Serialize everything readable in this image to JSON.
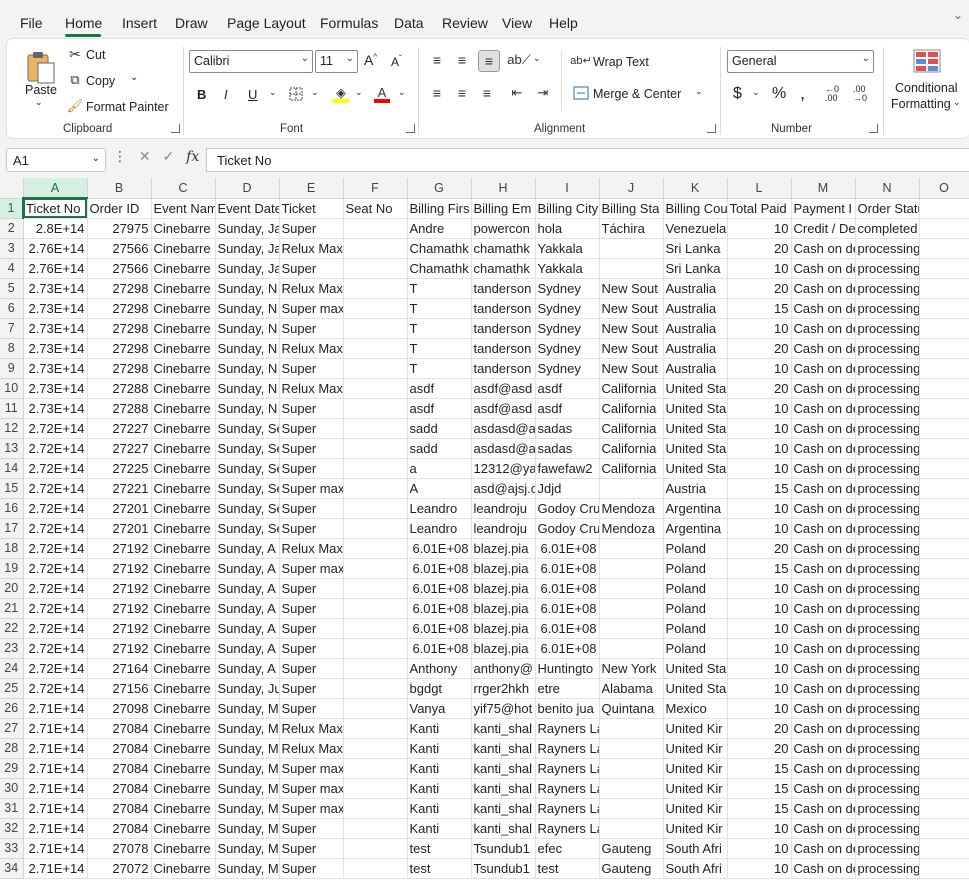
{
  "menu": {
    "tabs": [
      "File",
      "Home",
      "Insert",
      "Draw",
      "Page Layout",
      "Formulas",
      "Data",
      "Review",
      "View",
      "Help"
    ],
    "active": "Home"
  },
  "ribbon": {
    "clipboard": {
      "paste": "Paste",
      "cut": "Cut",
      "copy": "Copy",
      "format_painter": "Format Painter",
      "label": "Clipboard"
    },
    "font": {
      "name": "Calibri",
      "size": "11",
      "bold": "B",
      "italic": "I",
      "underline": "U",
      "label": "Font",
      "fill_color": "#ffff00",
      "font_color": "#ff0000"
    },
    "alignment": {
      "wrap_text": "Wrap Text",
      "merge_center": "Merge & Center",
      "label": "Alignment"
    },
    "number": {
      "format": "General",
      "label": "Number"
    },
    "styles": {
      "conditional_formatting_1": "Conditional",
      "conditional_formatting_2": "Formatting"
    }
  },
  "formula_bar": {
    "name_box": "A1",
    "formula": "Ticket No"
  },
  "sheet": {
    "columns": [
      "A",
      "B",
      "C",
      "D",
      "E",
      "F",
      "G",
      "H",
      "I",
      "J",
      "K",
      "L",
      "M",
      "N",
      "O"
    ],
    "rows": [
      [
        "Ticket No",
        "Order ID",
        "Event Nam",
        "Event Date",
        "Ticket",
        "Seat No",
        "Billing Firs",
        "Billing Em",
        "Billing City",
        "Billing Sta",
        "Billing Cou",
        "Total Paid",
        "Payment I",
        "Order Status",
        ""
      ],
      [
        "2.8E+14",
        "27975",
        "Cinebarre",
        "Sunday, Ja",
        "Super",
        "",
        "Andre",
        "powercon",
        "hola",
        "Táchira",
        "Venezuela",
        "10",
        "Credit / De",
        "completed",
        ""
      ],
      [
        "2.76E+14",
        "27566",
        "Cinebarre",
        "Sunday, Ja",
        "Relux Max",
        "",
        "Chamathk",
        "chamathk",
        "Yakkala",
        "",
        "Sri Lanka",
        "20",
        "Cash on de",
        "processing",
        ""
      ],
      [
        "2.76E+14",
        "27566",
        "Cinebarre",
        "Sunday, Ja",
        "Super",
        "",
        "Chamathk",
        "chamathk",
        "Yakkala",
        "",
        "Sri Lanka",
        "10",
        "Cash on de",
        "processing",
        ""
      ],
      [
        "2.73E+14",
        "27298",
        "Cinebarre",
        "Sunday, N",
        "Relux Max",
        "",
        "T",
        "tanderson",
        "Sydney",
        "New Sout",
        "Australia",
        "20",
        "Cash on de",
        "processing",
        ""
      ],
      [
        "2.73E+14",
        "27298",
        "Cinebarre",
        "Sunday, N",
        "Super max",
        "",
        "T",
        "tanderson",
        "Sydney",
        "New Sout",
        "Australia",
        "15",
        "Cash on de",
        "processing",
        ""
      ],
      [
        "2.73E+14",
        "27298",
        "Cinebarre",
        "Sunday, N",
        "Super",
        "",
        "T",
        "tanderson",
        "Sydney",
        "New Sout",
        "Australia",
        "10",
        "Cash on de",
        "processing",
        ""
      ],
      [
        "2.73E+14",
        "27298",
        "Cinebarre",
        "Sunday, N",
        "Relux Max",
        "",
        "T",
        "tanderson",
        "Sydney",
        "New Sout",
        "Australia",
        "20",
        "Cash on de",
        "processing",
        ""
      ],
      [
        "2.73E+14",
        "27298",
        "Cinebarre",
        "Sunday, N",
        "Super",
        "",
        "T",
        "tanderson",
        "Sydney",
        "New Sout",
        "Australia",
        "10",
        "Cash on de",
        "processing",
        ""
      ],
      [
        "2.73E+14",
        "27288",
        "Cinebarre",
        "Sunday, N",
        "Relux Max",
        "",
        "asdf",
        "asdf@asd",
        "asdf",
        "California",
        "United Sta",
        "20",
        "Cash on de",
        "processing",
        ""
      ],
      [
        "2.73E+14",
        "27288",
        "Cinebarre",
        "Sunday, N",
        "Super",
        "",
        "asdf",
        "asdf@asd",
        "asdf",
        "California",
        "United Sta",
        "10",
        "Cash on de",
        "processing",
        ""
      ],
      [
        "2.72E+14",
        "27227",
        "Cinebarre",
        "Sunday, Se",
        "Super",
        "",
        "sadd",
        "asdasd@a",
        "sadas",
        "California",
        "United Sta",
        "10",
        "Cash on de",
        "processing",
        ""
      ],
      [
        "2.72E+14",
        "27227",
        "Cinebarre",
        "Sunday, Se",
        "Super",
        "",
        "sadd",
        "asdasd@a",
        "sadas",
        "California",
        "United Sta",
        "10",
        "Cash on de",
        "processing",
        ""
      ],
      [
        "2.72E+14",
        "27225",
        "Cinebarre",
        "Sunday, Se",
        "Super",
        "",
        "a",
        "12312@ya",
        "fawefaw2",
        "California",
        "United Sta",
        "10",
        "Cash on de",
        "processing",
        ""
      ],
      [
        "2.72E+14",
        "27221",
        "Cinebarre",
        "Sunday, Se",
        "Super max",
        "",
        "A",
        "asd@ajsj.c",
        "Jdjd",
        "",
        "Austria",
        "15",
        "Cash on de",
        "processing",
        ""
      ],
      [
        "2.72E+14",
        "27201",
        "Cinebarre",
        "Sunday, Se",
        "Super",
        "",
        "Leandro",
        "leandroju",
        "Godoy Cru",
        "Mendoza",
        "Argentina",
        "10",
        "Cash on de",
        "processing",
        ""
      ],
      [
        "2.72E+14",
        "27201",
        "Cinebarre",
        "Sunday, Se",
        "Super",
        "",
        "Leandro",
        "leandroju",
        "Godoy Cru",
        "Mendoza",
        "Argentina",
        "10",
        "Cash on de",
        "processing",
        ""
      ],
      [
        "2.72E+14",
        "27192",
        "Cinebarre",
        "Sunday, A",
        "Relux Max",
        "",
        "6.01E+08",
        "blazej.pia",
        "6.01E+08",
        "",
        "Poland",
        "20",
        "Cash on de",
        "processing",
        ""
      ],
      [
        "2.72E+14",
        "27192",
        "Cinebarre",
        "Sunday, A",
        "Super max",
        "",
        "6.01E+08",
        "blazej.pia",
        "6.01E+08",
        "",
        "Poland",
        "15",
        "Cash on de",
        "processing",
        ""
      ],
      [
        "2.72E+14",
        "27192",
        "Cinebarre",
        "Sunday, A",
        "Super",
        "",
        "6.01E+08",
        "blazej.pia",
        "6.01E+08",
        "",
        "Poland",
        "10",
        "Cash on de",
        "processing",
        ""
      ],
      [
        "2.72E+14",
        "27192",
        "Cinebarre",
        "Sunday, A",
        "Super",
        "",
        "6.01E+08",
        "blazej.pia",
        "6.01E+08",
        "",
        "Poland",
        "10",
        "Cash on de",
        "processing",
        ""
      ],
      [
        "2.72E+14",
        "27192",
        "Cinebarre",
        "Sunday, A",
        "Super",
        "",
        "6.01E+08",
        "blazej.pia",
        "6.01E+08",
        "",
        "Poland",
        "10",
        "Cash on de",
        "processing",
        ""
      ],
      [
        "2.72E+14",
        "27192",
        "Cinebarre",
        "Sunday, A",
        "Super",
        "",
        "6.01E+08",
        "blazej.pia",
        "6.01E+08",
        "",
        "Poland",
        "10",
        "Cash on de",
        "processing",
        ""
      ],
      [
        "2.72E+14",
        "27164",
        "Cinebarre",
        "Sunday, A",
        "Super",
        "",
        "Anthony",
        "anthony@",
        "Huntingto",
        "New York",
        "United Sta",
        "10",
        "Cash on de",
        "processing",
        ""
      ],
      [
        "2.72E+14",
        "27156",
        "Cinebarre",
        "Sunday, Ju",
        "Super",
        "",
        "bgdgt",
        "rrger2hkh",
        "etre",
        "Alabama",
        "United Sta",
        "10",
        "Cash on de",
        "processing",
        ""
      ],
      [
        "2.71E+14",
        "27098",
        "Cinebarre",
        "Sunday, M",
        "Super",
        "",
        "Vanya",
        "yif75@hot",
        "benito jua",
        "Quintana",
        "Mexico",
        "10",
        "Cash on de",
        "processing",
        ""
      ],
      [
        "2.71E+14",
        "27084",
        "Cinebarre",
        "Sunday, M",
        "Relux Max",
        "",
        "Kanti",
        "kanti_shal",
        "Rayners La",
        "",
        "United Kir",
        "20",
        "Cash on de",
        "processing",
        ""
      ],
      [
        "2.71E+14",
        "27084",
        "Cinebarre",
        "Sunday, M",
        "Relux Max",
        "",
        "Kanti",
        "kanti_shal",
        "Rayners La",
        "",
        "United Kir",
        "20",
        "Cash on de",
        "processing",
        ""
      ],
      [
        "2.71E+14",
        "27084",
        "Cinebarre",
        "Sunday, M",
        "Super max",
        "",
        "Kanti",
        "kanti_shal",
        "Rayners La",
        "",
        "United Kir",
        "15",
        "Cash on de",
        "processing",
        ""
      ],
      [
        "2.71E+14",
        "27084",
        "Cinebarre",
        "Sunday, M",
        "Super max",
        "",
        "Kanti",
        "kanti_shal",
        "Rayners La",
        "",
        "United Kir",
        "15",
        "Cash on de",
        "processing",
        ""
      ],
      [
        "2.71E+14",
        "27084",
        "Cinebarre",
        "Sunday, M",
        "Super max",
        "",
        "Kanti",
        "kanti_shal",
        "Rayners La",
        "",
        "United Kir",
        "15",
        "Cash on de",
        "processing",
        ""
      ],
      [
        "2.71E+14",
        "27084",
        "Cinebarre",
        "Sunday, M",
        "Super",
        "",
        "Kanti",
        "kanti_shal",
        "Rayners La",
        "",
        "United Kir",
        "10",
        "Cash on de",
        "processing",
        ""
      ],
      [
        "2.71E+14",
        "27078",
        "Cinebarre",
        "Sunday, M",
        "Super",
        "",
        "test",
        "Tsundub1",
        "efec",
        "Gauteng",
        "South Afri",
        "10",
        "Cash on de",
        "processing",
        ""
      ],
      [
        "2.71E+14",
        "27072",
        "Cinebarre",
        "Sunday, M",
        "Super",
        "",
        "test",
        "Tsundub1",
        "test",
        "Gauteng",
        "South Afri",
        "10",
        "Cash on de",
        "processing",
        ""
      ]
    ]
  }
}
